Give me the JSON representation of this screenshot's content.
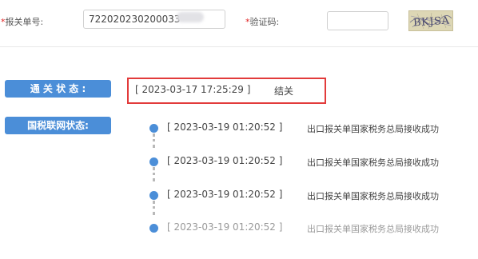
{
  "form": {
    "required_mark": "*",
    "declaration_label": "报关单号:",
    "declaration_value": "722020230200033",
    "captcha_label": "验证码:",
    "captcha_value": "",
    "captcha_image_text": "BKJSA"
  },
  "customs": {
    "label": "通 关 状 态 :",
    "time": "[ 2023-03-17 17:25:29 ]",
    "status": "结关"
  },
  "tax": {
    "label": "国税联网状态:",
    "items": [
      {
        "time": "[ 2023-03-19 01:20:52 ]",
        "text": "出口报关单国家税务总局接收成功"
      },
      {
        "time": "[ 2023-03-19 01:20:52 ]",
        "text": "出口报关单国家税务总局接收成功"
      },
      {
        "time": "[ 2023-03-19 01:20:52 ]",
        "text": "出口报关单国家税务总局接收成功"
      },
      {
        "time": "[ 2023-03-19 01:20:52 ]",
        "text": "出口报关单国家税务总局接收成功"
      }
    ]
  },
  "colors": {
    "accent": "#4b8ed8",
    "highlight_border": "#e23b3b",
    "required": "#e02020"
  }
}
